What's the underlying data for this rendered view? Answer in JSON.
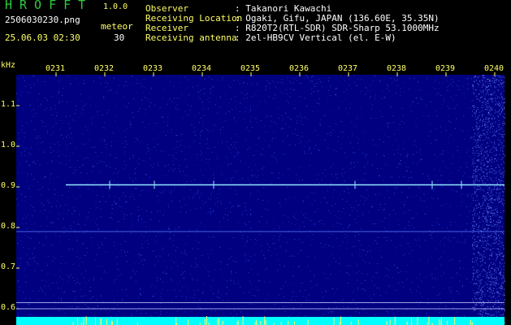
{
  "header": {
    "app_title": "HROFFT",
    "version": "1.0.0",
    "filename": "2506030230.png",
    "meteor_label": "meteor",
    "datetime": "25.06.03 02:30",
    "meteor_count": "30"
  },
  "info": [
    {
      "label": "Observer",
      "value": ": Takanori Kawachi"
    },
    {
      "label": "Receiving Location",
      "value": ": Ogaki, Gifu, JAPAN (136.60E, 35.35N)"
    },
    {
      "label": "Receiver",
      "value": ": R820T2(RTL-SDR) SDR-Sharp 53.1000MHz"
    },
    {
      "label": "Receiving antenna",
      "value": ": 2el-HB9CV Vertical (el. E-W)"
    }
  ],
  "plot": {
    "y_unit": "kHz",
    "y_ticks": [
      "1.1",
      "1.0",
      "0.9",
      "0.8",
      "0.7",
      "0.6"
    ],
    "x_ticks": [
      "0231",
      "0232",
      "0233",
      "0234",
      "0235",
      "0236",
      "0237",
      "0238",
      "0239",
      "0240"
    ],
    "colors": {
      "background": "#000080",
      "noise": "#3a5aff",
      "carrier": "#8fe6ff",
      "bottom_band": "#00ffff",
      "tick_text": "#ffff66"
    }
  },
  "chart_data": {
    "type": "heatmap",
    "ylabel": "kHz",
    "y_range": [
      0.6,
      1.15
    ],
    "x_categories": [
      "0231",
      "0232",
      "0233",
      "0234",
      "0235",
      "0236",
      "0237",
      "0238",
      "0239",
      "0240"
    ],
    "features": [
      {
        "kind": "carrier",
        "freq_khz": 0.905,
        "from": "0231",
        "to": "0240"
      },
      {
        "kind": "faint_line",
        "freq_khz": 0.79
      },
      {
        "kind": "reference_line",
        "freq_khz": 0.615
      },
      {
        "kind": "reference_line",
        "freq_khz": 0.6
      }
    ]
  }
}
